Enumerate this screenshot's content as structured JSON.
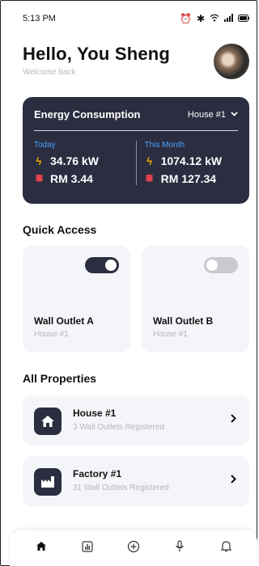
{
  "status_bar": {
    "time": "5:13 PM",
    "icons": [
      "alarm-icon",
      "bluetooth-icon",
      "wifi-icon",
      "signal-icon",
      "battery-icon"
    ]
  },
  "header": {
    "greeting": "Hello, You Sheng",
    "subtitle": "Welcome back"
  },
  "energy": {
    "title": "Energy Consumption",
    "selected_house": "House #1",
    "today": {
      "label": "Today",
      "power": "34.76 kW",
      "cost": "RM 3.44"
    },
    "this_month": {
      "label": "This Month",
      "power": "1074.12 kW",
      "cost": "RM 127.34"
    }
  },
  "quick_access": {
    "title": "Quick Access",
    "items": [
      {
        "name": "Wall Outlet A",
        "location": "House #1",
        "on": true
      },
      {
        "name": "Wall Outlet B",
        "location": "House #1",
        "on": false
      }
    ]
  },
  "properties": {
    "title": "All Properties",
    "items": [
      {
        "name": "House #1",
        "detail": "3 Wall Outlets Registered",
        "icon": "home-icon"
      },
      {
        "name": "Factory #1",
        "detail": "31 Wall Outlets Registered",
        "icon": "factory-icon"
      }
    ]
  },
  "nav": {
    "items": [
      "home-icon",
      "chart-icon",
      "add-icon",
      "microphone-icon",
      "bell-icon"
    ],
    "active": "home-icon"
  },
  "colors": {
    "primary": "#2b2d40",
    "accent_blue": "#4aa3ff",
    "bolt": "#f2a900",
    "coin": "#e2424c",
    "card_bg": "#f4f5f8"
  }
}
